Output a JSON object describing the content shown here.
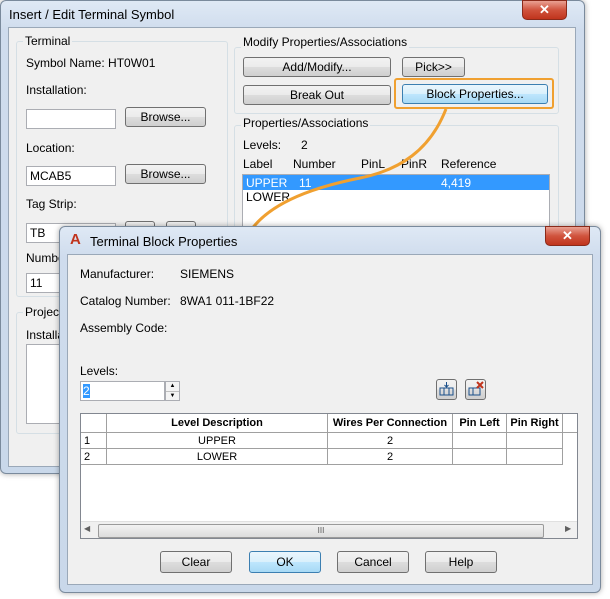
{
  "back_dialog": {
    "title": "Insert / Edit Terminal Symbol",
    "close": "✕",
    "terminal": {
      "group_label": "Terminal",
      "symbol_name": "Symbol Name: HT0W01",
      "installation_label": "Installation:",
      "installation_value": "",
      "location_label": "Location:",
      "location_value": "MCAB5",
      "tag_strip_label": "Tag Strip:",
      "tag_strip_value": "TB",
      "number_label": "Number",
      "number_value": "11",
      "browse": "Browse..."
    },
    "project": {
      "group_label": "Project",
      "installation_label": "Installati"
    },
    "modify": {
      "group_label": "Modify Properties/Associations",
      "add_modify": "Add/Modify...",
      "pick": "Pick>>",
      "break_out": "Break Out",
      "block_properties": "Block Properties..."
    },
    "props": {
      "group_label": "Properties/Associations",
      "levels_label": "Levels:",
      "levels_value": "2",
      "columns": [
        "Label",
        "Number",
        "PinL",
        "PinR",
        "Reference"
      ],
      "rows": [
        {
          "label": "UPPER",
          "number": "11",
          "pinl": "",
          "pinr": "",
          "reference": "4,419"
        },
        {
          "label": "LOWER",
          "number": "",
          "pinl": "",
          "pinr": "",
          "reference": ""
        }
      ]
    }
  },
  "front_dialog": {
    "title": "Terminal Block Properties",
    "app_icon": "A",
    "close": "✕",
    "manufacturer_label": "Manufacturer:",
    "manufacturer_value": "SIEMENS",
    "catalog_label": "Catalog Number:",
    "catalog_value": "8WA1 011-1BF22",
    "assembly_label": "Assembly Code:",
    "assembly_value": "",
    "levels_label": "Levels:",
    "levels_value": "2",
    "icons": [
      "insert-level-icon",
      "delete-level-icon"
    ],
    "grid": {
      "columns": [
        "",
        "Level Description",
        "Wires Per Connection",
        "Pin Left",
        "Pin Right"
      ],
      "rows": [
        {
          "index": "1",
          "description": "UPPER",
          "wires": "2",
          "pin_left": "",
          "pin_right": ""
        },
        {
          "index": "2",
          "description": "LOWER",
          "wires": "2",
          "pin_left": "",
          "pin_right": ""
        }
      ],
      "scroll_thumb": "III"
    },
    "buttons": {
      "clear": "Clear",
      "ok": "OK",
      "cancel": "Cancel",
      "help": "Help"
    }
  },
  "colors": {
    "selection": "#3399ff",
    "highlight": "#f0a030",
    "accent_red": "#c0341d"
  }
}
